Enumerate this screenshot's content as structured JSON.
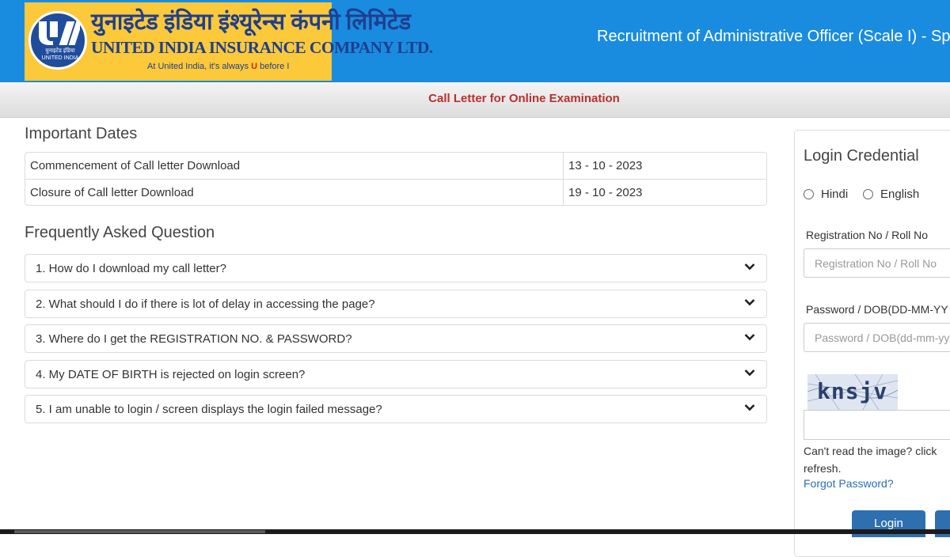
{
  "header": {
    "logo": {
      "hindi_name": "युनाइटेड इंडिया इंश्यूरेन्स कंपनी लिमिटेड",
      "english_name": "UNITED INDIA INSURANCE COMPANY LTD.",
      "tagline_prefix": "At United India, it's always ",
      "tagline_u": "U",
      "tagline_suffix": " before I",
      "mini_hindi": "युनाइटेड इंडिया",
      "mini_english": "UNITED INDIA"
    },
    "title": "Recruitment of Administrative Officer (Scale I) - Sp"
  },
  "subheader": {
    "title": "Call Letter for Online Examination"
  },
  "important_dates": {
    "title": "Important Dates",
    "rows": [
      {
        "label": "Commencement of Call letter Download",
        "value": "13 - 10 - 2023"
      },
      {
        "label": "Closure of Call letter Download",
        "value": "19 - 10 - 2023"
      }
    ]
  },
  "faq": {
    "title": "Frequently Asked Question",
    "items": [
      "1. How do I download my call letter?",
      "2. What should I do if there is lot of delay in accessing the page?",
      "3. Where do I get the REGISTRATION NO. & PASSWORD?",
      "4. My DATE OF BIRTH is rejected on login screen?",
      "5. I am unable to login / screen displays the login failed message?"
    ]
  },
  "login": {
    "title": "Login Credential",
    "languages": [
      "Hindi",
      "English"
    ],
    "registration_label": "Registration No / Roll No",
    "registration_placeholder": "Registration No / Roll No",
    "password_label": "Password / DOB(DD-MM-YY",
    "password_placeholder": "Password / DOB(dd-mm-yy",
    "captcha_text": "knsjv",
    "captcha_hint": "Can't read the image? click refresh.",
    "forgot_password": "Forgot Password?",
    "login_button": "Login"
  },
  "colors": {
    "header_blue": "#1a8ce0",
    "logo_yellow": "#fcc93a",
    "logo_navy": "#1f3f8f",
    "subheader_red": "#b8312f",
    "button_blue": "#2e6fb0",
    "link_blue": "#2a6ebb"
  }
}
